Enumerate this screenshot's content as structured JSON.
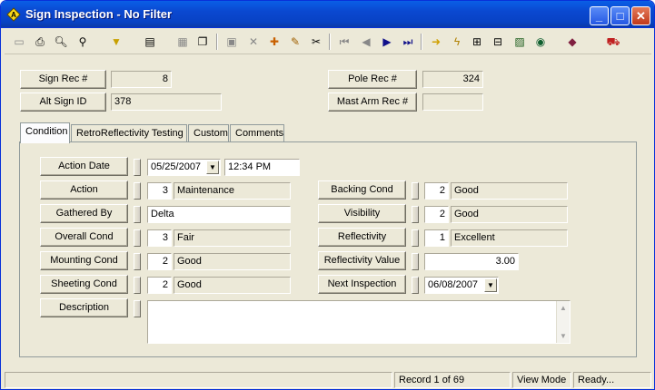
{
  "window": {
    "title": "Sign Inspection - No Filter",
    "minimize": "_",
    "maximize": "□",
    "close": "✕"
  },
  "toolbar": {
    "icons": [
      "new-record",
      "print",
      "print-preview",
      "binoculars",
      "filter",
      "form-select",
      "edit-form",
      "copy-record",
      "save",
      "delete",
      "image",
      "pencil",
      "scissors",
      "first",
      "previous",
      "next",
      "last",
      "arrow-right",
      "lightning",
      "tree",
      "gallery",
      "image-view",
      "globe",
      "book",
      "car"
    ]
  },
  "header": {
    "sign_rec_label": "Sign Rec #",
    "sign_rec_value": "8",
    "alt_sign_label": "Alt Sign ID",
    "alt_sign_value": "378",
    "pole_rec_label": "Pole Rec #",
    "pole_rec_value": "324",
    "mast_arm_label": "Mast Arm Rec #",
    "mast_arm_value": ""
  },
  "tabs": [
    "Condition",
    "RetroReflectivity Testing",
    "Custom",
    "Comments"
  ],
  "condition": {
    "action_date_label": "Action Date",
    "action_date": "05/25/2007",
    "action_time": "12:34 PM",
    "action_label": "Action",
    "action_code": "3",
    "action_text": "Maintenance",
    "gathered_by_label": "Gathered By",
    "gathered_by": "Delta",
    "overall_label": "Overall Cond",
    "overall_code": "3",
    "overall_text": "Fair",
    "mounting_label": "Mounting Cond",
    "mounting_code": "2",
    "mounting_text": "Good",
    "sheeting_label": "Sheeting Cond",
    "sheeting_code": "2",
    "sheeting_text": "Good",
    "description_label": "Description",
    "description": "",
    "backing_label": "Backing Cond",
    "backing_code": "2",
    "backing_text": "Good",
    "visibility_label": "Visibility",
    "visibility_code": "2",
    "visibility_text": "Good",
    "reflectivity_label": "Reflectivity",
    "reflectivity_code": "1",
    "reflectivity_text": "Excellent",
    "refl_value_label": "Reflectivity Value",
    "refl_value": "3.00",
    "next_insp_label": "Next Inspection",
    "next_insp": "06/08/2007"
  },
  "status": {
    "record": "Record 1 of 69",
    "mode": "View Mode",
    "state": "Ready..."
  }
}
